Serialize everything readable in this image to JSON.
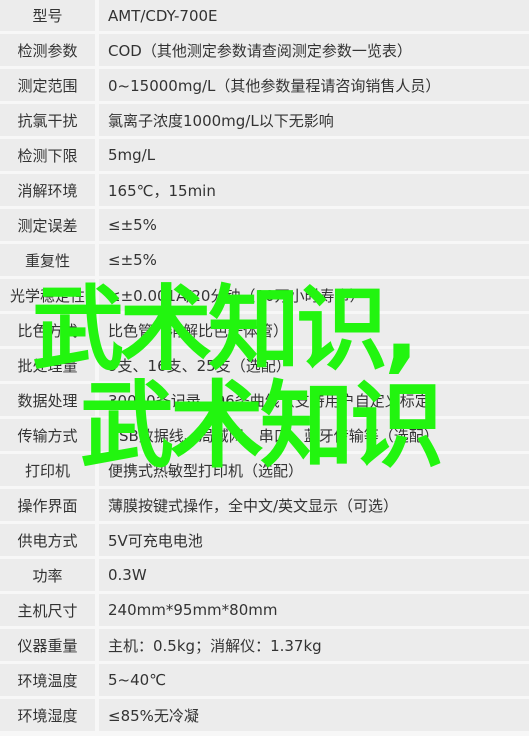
{
  "specs": [
    {
      "label": "型号",
      "value": "AMT/CDY-700E"
    },
    {
      "label": "检测参数",
      "value": "COD（其他测定参数请查阅测定参数一览表）"
    },
    {
      "label": "测定范围",
      "value": "0~15000mg/L（其他参数量程请咨询销售人员）"
    },
    {
      "label": "抗氯干扰",
      "value": "氯离子浓度1000mg/L以下无影响"
    },
    {
      "label": "检测下限",
      "value": "5mg/L"
    },
    {
      "label": "消解环境",
      "value": "165℃，15min"
    },
    {
      "label": "测定误差",
      "value": "≤±5%"
    },
    {
      "label": "重复性",
      "value": "≤±5%"
    },
    {
      "label": "光学稳定性",
      "value": "≤±0.001A/20分钟（10万小时寿命）"
    },
    {
      "label": "比色方式",
      "value": "比色管（消解比色一体管）"
    },
    {
      "label": "批处理量",
      "value": "9支、16支、25支（选配）"
    },
    {
      "label": "数据处理",
      "value": "30000条记录，96条曲线（支持用户自定义标定）"
    },
    {
      "label": "传输方式",
      "value": "USB数据线、局域网、串口、蓝牙传输等（选配）"
    },
    {
      "label": "打印机",
      "value": "便携式热敏型打印机（选配）"
    },
    {
      "label": "操作界面",
      "value": "薄膜按键式操作，全中文/英文显示（可选）"
    },
    {
      "label": "供电方式",
      "value": "5V可充电电池"
    },
    {
      "label": "功率",
      "value": "0.3W"
    },
    {
      "label": "主机尺寸",
      "value": "240mm*95mm*80mm"
    },
    {
      "label": "仪器重量",
      "value": "主机：0.5kg；消解仪：1.37kg"
    },
    {
      "label": "环境温度",
      "value": "5~40℃"
    },
    {
      "label": "环境湿度",
      "value": "≤85%无冷凝"
    }
  ],
  "overlay": {
    "line1": "武术知识,",
    "line2": "武术知识",
    "color": "#22f50f"
  }
}
